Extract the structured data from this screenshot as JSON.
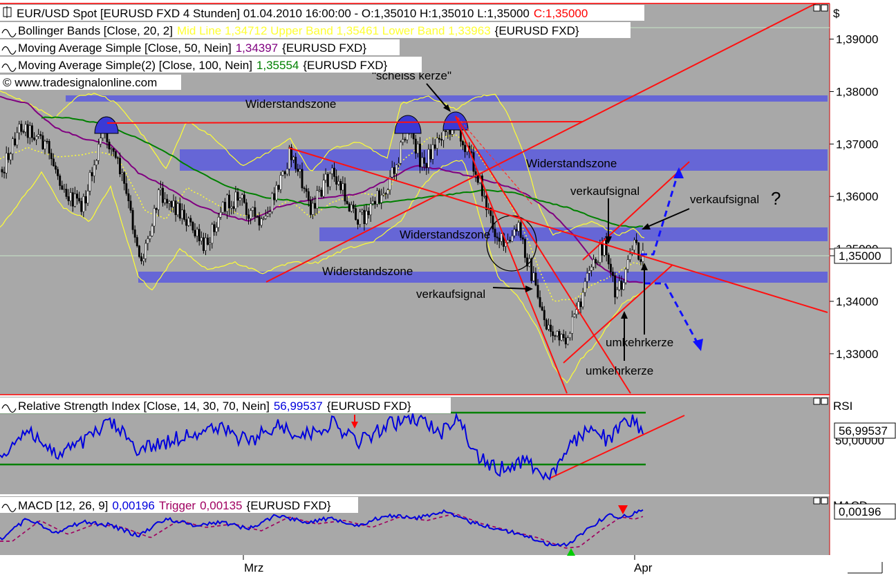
{
  "header": {
    "title_line": "EUR/USD Spot [EURUSD FXD  4 Stunden] 01.04.2010 16:00:00 - O:1,35010 H:1,35010 L:1,35000",
    "close_label": "C:1,35000",
    "copyright": "© www.tradesignalonline.com"
  },
  "legend": {
    "bollinger_prefix": "Bollinger Bands [Close, 20, 2]",
    "bollinger_values": "Mid Line 1,34712 Upper Band 1,35461 Lower Band 1,33963",
    "bollinger_suffix": "{EURUSD FXD}",
    "ma50_prefix": "Moving Average Simple [Close, 50, Nein]",
    "ma50_value": "1,34397",
    "ma50_suffix": "{EURUSD FXD}",
    "ma100_prefix": "Moving Average Simple(2) [Close, 100, Nein]",
    "ma100_value": "1,35554",
    "ma100_suffix": "{EURUSD FXD}",
    "rsi_prefix": "Relative Strength Index [Close, 14, 30, 70, Nein]",
    "rsi_value": "56,99537",
    "rsi_suffix": "{EURUSD FXD}",
    "macd_prefix": "MACD [12, 26, 9]",
    "macd_value": "0,00196",
    "macd_trigger_label": "Trigger",
    "macd_trigger_value": "0,00135",
    "macd_suffix": "{EURUSD FXD}"
  },
  "axis": {
    "currency_symbol": "$",
    "rsi_label": "RSI",
    "macd_label": "MACD",
    "price_current": "1,35000",
    "rsi_current": "56,99537",
    "rsi_tick_50": "50,00000",
    "macd_current": "0,00196",
    "x_labels": [
      "Mrz",
      "Apr"
    ]
  },
  "annotations": {
    "zone_1": "Widerstandszone",
    "zone_2": "Widerstandszone",
    "zone_3": "Widerstandszone",
    "zone_4": "Widerstandszone",
    "scheiss": "\"scheiss kerze\"",
    "verkauf_1": "verkaufsignal",
    "verkauf_2": "verkaufsignal",
    "verkauf_3": "verkaufsignal",
    "question": "?",
    "umkehr_1": "umkehrkerze",
    "umkehr_2": "umkehrkerze"
  },
  "colors": {
    "panel_bg": "#a8a8a8",
    "zone": "#6666d6",
    "bollinger": "#ffff33",
    "ma50": "#800080",
    "ma100": "#008000",
    "trendline": "#ff0000",
    "rsi": "#0000dd",
    "macd": "#0000dd",
    "macd_trigger": "#a00060",
    "rsi_level": "#008000",
    "signal_arrow": "#0000ff"
  },
  "chart_data": [
    {
      "type": "candlestick",
      "title": "EUR/USD Spot [EURUSD FXD  4 Stunden]",
      "x_ticks": [
        "Mrz",
        "Apr"
      ],
      "y_ticks": [
        1.33,
        1.34,
        1.35,
        1.36,
        1.37,
        1.38,
        1.39
      ],
      "ylim": [
        1.3222,
        1.3968
      ],
      "last_close": 1.35,
      "ohlc_last": {
        "open": 1.3501,
        "high": 1.3501,
        "low": 1.35,
        "close": 1.35
      },
      "series": [
        {
          "name": "Bollinger Bands [Close, 20, 2]",
          "mid": 1.34712,
          "upper": 1.35461,
          "lower": 1.33963
        },
        {
          "name": "Moving Average Simple [Close, 50, Nein]",
          "last": 1.34397
        },
        {
          "name": "Moving Average Simple(2) [Close, 100, Nein]",
          "last": 1.35554
        }
      ],
      "resistance_zones": [
        [
          1.3835,
          1.3848
        ],
        [
          1.3685,
          1.3732
        ],
        [
          1.3528,
          1.3558
        ],
        [
          1.3448,
          1.347
        ]
      ],
      "grid": false
    },
    {
      "type": "line",
      "title": "Relative Strength Index [Close, 14, 30, 70, Nein]",
      "last": 56.99537,
      "levels": [
        30,
        70
      ],
      "y_ticks": [
        50
      ]
    },
    {
      "type": "line",
      "title": "MACD [12, 26, 9]",
      "series": [
        {
          "name": "MACD",
          "last": 0.00196
        },
        {
          "name": "Trigger",
          "last": 0.00135
        }
      ]
    }
  ]
}
